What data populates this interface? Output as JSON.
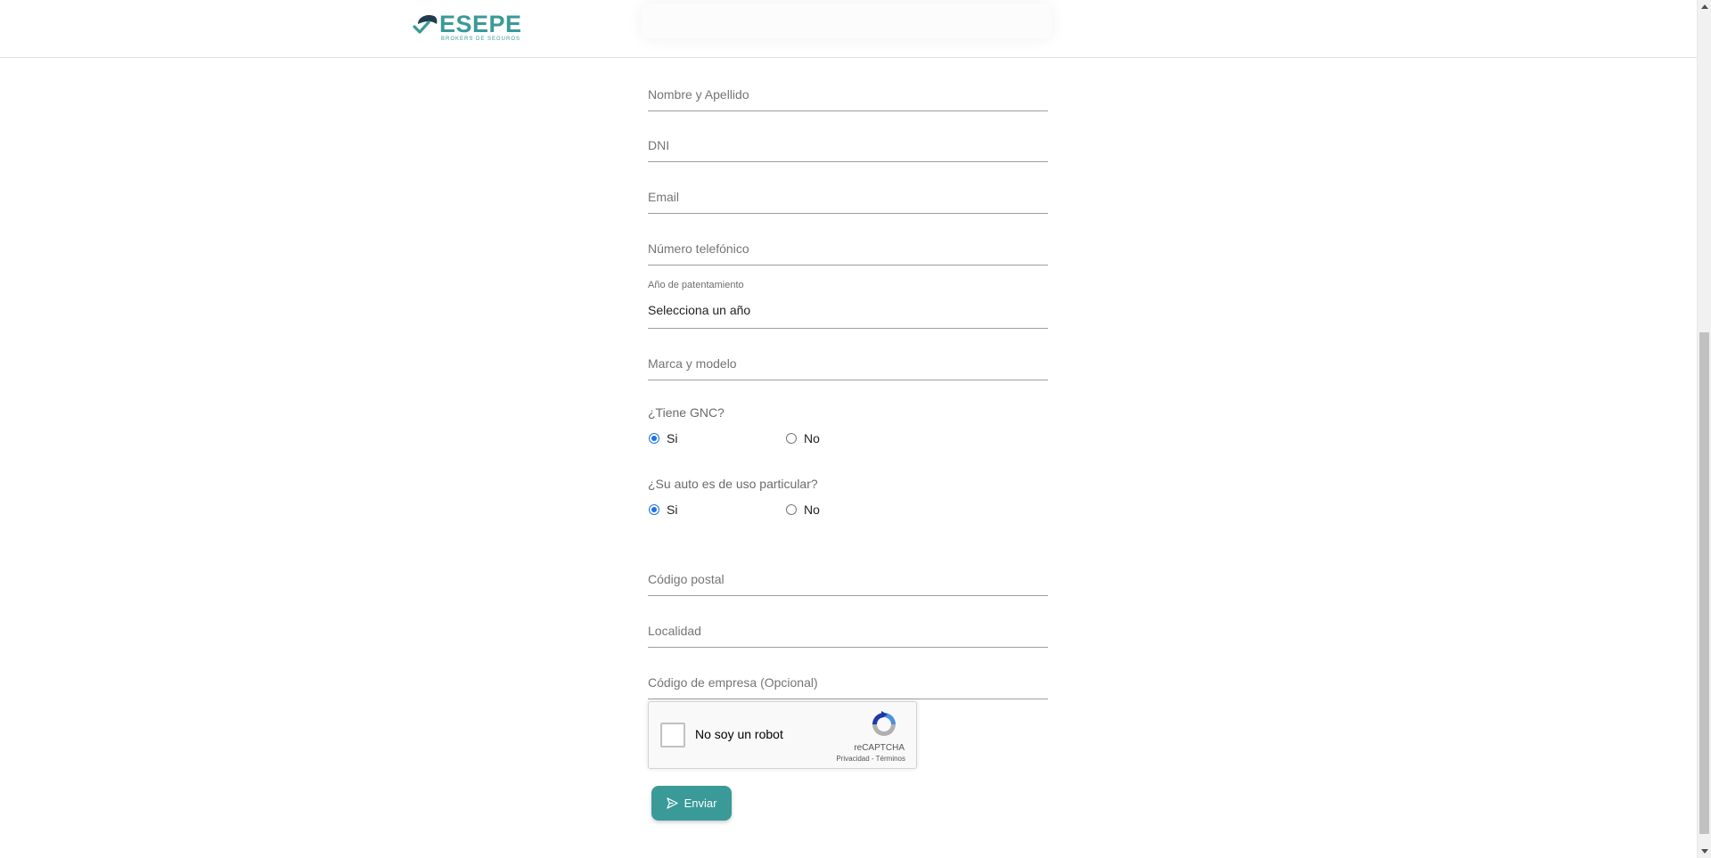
{
  "brand": {
    "name": "ESEPE",
    "tagline": "BROKERS DE SEGUROS",
    "color": "#3a9a98"
  },
  "form": {
    "fields": {
      "nombre": "Nombre y Apellido",
      "dni": "DNI",
      "email": "Email",
      "telefono": "Número telefónico",
      "marca": "Marca y modelo",
      "codigo_postal": "Código postal",
      "localidad": "Localidad",
      "codigo_empresa": "Código de empresa (Opcional)"
    },
    "anio": {
      "label": "Año de patentamiento",
      "value": "Selecciona un año"
    },
    "gnc": {
      "question": "¿Tiene GNC?",
      "options": [
        "Si",
        "No"
      ],
      "selected": "Si"
    },
    "uso_particular": {
      "question": "¿Su auto es de uso particular?",
      "options": [
        "Si",
        "No"
      ],
      "selected": "Si"
    },
    "recaptcha": {
      "label": "No soy un robot",
      "brand": "reCAPTCHA",
      "links": "Privacidad - Términos"
    },
    "submit": {
      "label": "Enviar",
      "icon": "send-icon"
    }
  }
}
